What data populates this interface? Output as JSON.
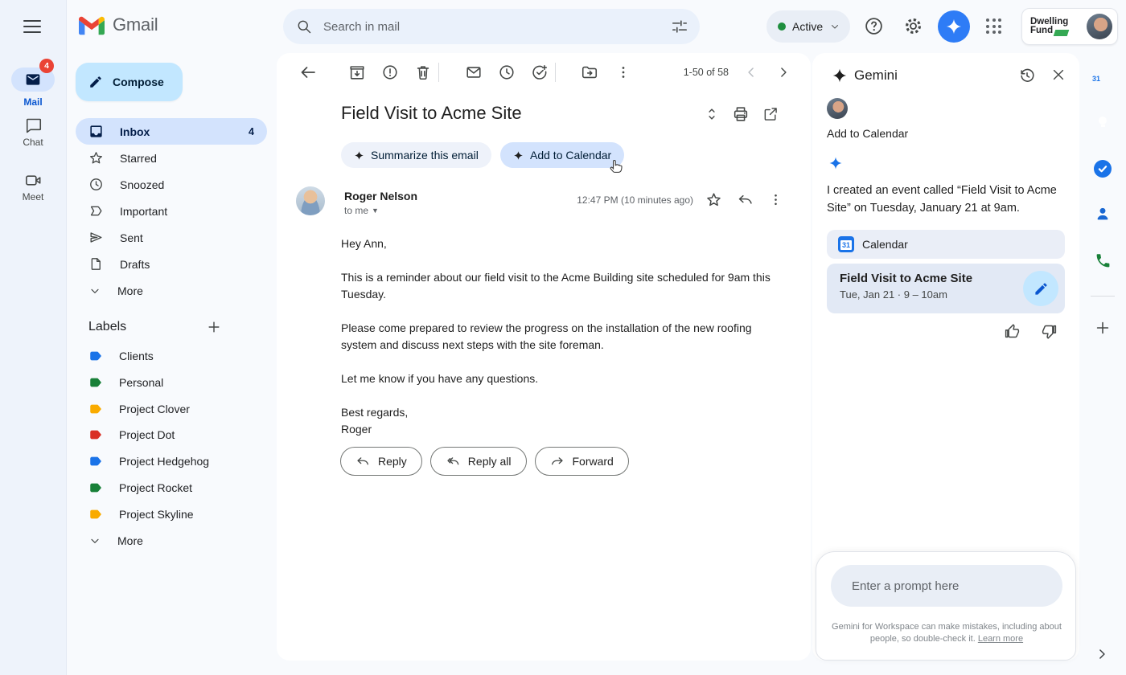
{
  "topbar": {
    "brand": "Gmail",
    "search_placeholder": "Search in mail",
    "status_label": "Active",
    "account_org_line1": "Dwelling",
    "account_org_line2": "Fund"
  },
  "left_rail": {
    "mail_label": "Mail",
    "mail_badge": "4",
    "chat_label": "Chat",
    "meet_label": "Meet"
  },
  "sidebar": {
    "compose_label": "Compose",
    "items": [
      {
        "label": "Inbox",
        "count": "4"
      },
      {
        "label": "Starred"
      },
      {
        "label": "Snoozed"
      },
      {
        "label": "Important"
      },
      {
        "label": "Sent"
      },
      {
        "label": "Drafts"
      },
      {
        "label": "More"
      }
    ],
    "labels_header": "Labels",
    "labels": [
      {
        "label": "Clients",
        "color": "#1a73e8"
      },
      {
        "label": "Personal",
        "color": "#188038"
      },
      {
        "label": "Project Clover",
        "color": "#f9ab00"
      },
      {
        "label": "Project Dot",
        "color": "#d93025"
      },
      {
        "label": "Project Hedgehog",
        "color": "#1a73e8"
      },
      {
        "label": "Project Rocket",
        "color": "#188038"
      },
      {
        "label": "Project Skyline",
        "color": "#f9ab00"
      }
    ],
    "labels_more": "More"
  },
  "mail": {
    "pagination": "1-50 of 58",
    "subject": "Field Visit to Acme Site",
    "chip_summarize": "Summarize this email",
    "chip_add_to_calendar": "Add to Calendar",
    "sender_name": "Roger Nelson",
    "recipient": "to me",
    "timestamp": "12:47 PM (10 minutes ago)",
    "body_paragraphs": [
      "Hey Ann,",
      "This is a reminder about our field visit to the Acme Building site scheduled for 9am this Tuesday.",
      "Please come prepared to review the progress on the installation of the new roofing system and discuss next steps with the site foreman.",
      "Let me know if you have any questions.",
      "Best regards,\nRoger"
    ],
    "reply_label": "Reply",
    "reply_all_label": "Reply all",
    "forward_label": "Forward"
  },
  "gemini": {
    "title": "Gemini",
    "user_message": "Add to Calendar",
    "response": "I created an event called “Field Visit to Acme Site” on Tuesday, January 21 at 9am.",
    "calendar_chip_label": "Calendar",
    "event_title": "Field Visit to Acme Site",
    "event_time": "Tue, Jan 21 · 9 – 10am",
    "prompt_placeholder": "Enter a prompt here",
    "disclaimer": "Gemini for Workspace can make mistakes, including about people, so double-check it.",
    "learn_more_label": "Learn more"
  },
  "icons": {
    "calendar_day": "31"
  },
  "colors": {
    "accent_blue": "#0b57d0",
    "compose_bg": "#c2e7ff",
    "selected_bg": "#d3e3fd",
    "badge_red": "#ea4335",
    "gemini_blue": "#2e7cf6"
  }
}
